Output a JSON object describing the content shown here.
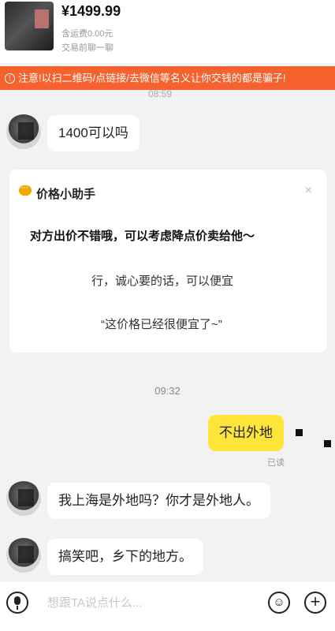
{
  "product": {
    "price": "¥1499.99",
    "shipping": "含运费0.00元",
    "status": "交易前聊一聊"
  },
  "warning": {
    "icon": "info-icon",
    "text": "注意!以扫二维码/点链接/去微信等名义让你交钱的都是骗子!"
  },
  "cut_time": "08:59",
  "messages": {
    "m1": "1400可以吗",
    "m3": "不出外地",
    "m4": "我上海是外地吗？你才是外地人。",
    "m5": "搞笑吧，乡下的地方。"
  },
  "assistant": {
    "icon": "chat-bubble-icon",
    "title": "价格小助手",
    "close": "×",
    "tip": "对方出价不错哦，可以考虑降点价卖给他～",
    "reply": "行，诚心要的话，可以便宜",
    "quote": "“这价格已经很便宜了~”"
  },
  "time_label": "09:32",
  "read_status": "已读",
  "input": {
    "placeholder": "想跟TA说点什么...",
    "emoji": "☺",
    "plus": "+"
  },
  "colors": {
    "banner": "#f5622e",
    "self_bubble": "#ffe43a",
    "background": "#f2f2f2"
  }
}
